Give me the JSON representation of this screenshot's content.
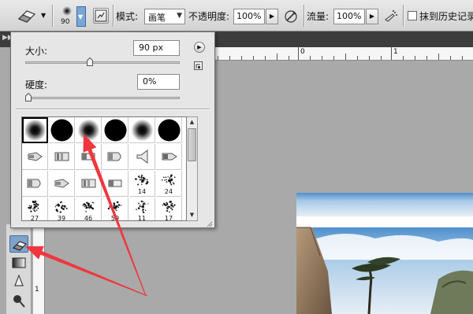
{
  "options_bar": {
    "brush_size_preview": "90",
    "mode_label": "模式:",
    "mode_value": "画笔",
    "opacity_label": "不透明度:",
    "opacity_value": "100%",
    "flow_label": "流量:",
    "flow_value": "100%",
    "erase_history_label": "抹到历史记录"
  },
  "brush_popup": {
    "size_label": "大小:",
    "size_value": "90 px",
    "size_slider_level": 0.42,
    "hardness_label": "硬度:",
    "hardness_value": "0%",
    "hardness_slider_level": 0.0,
    "presets": [
      {
        "kind": "soft",
        "label": ""
      },
      {
        "kind": "hard",
        "label": ""
      },
      {
        "kind": "soft",
        "label": ""
      },
      {
        "kind": "hard",
        "label": ""
      },
      {
        "kind": "soft",
        "label": ""
      },
      {
        "kind": "hard",
        "label": ""
      },
      {
        "kind": "marker",
        "label": ""
      },
      {
        "kind": "chalk",
        "label": ""
      },
      {
        "kind": "flat",
        "label": ""
      },
      {
        "kind": "wide",
        "label": ""
      },
      {
        "kind": "fan",
        "label": ""
      },
      {
        "kind": "pointed",
        "label": ""
      },
      {
        "kind": "wide",
        "label": ""
      },
      {
        "kind": "marker",
        "label": ""
      },
      {
        "kind": "chalk",
        "label": ""
      },
      {
        "kind": "flat",
        "label": ""
      },
      {
        "kind": "scatter",
        "label": "14"
      },
      {
        "kind": "scatter",
        "label": "24"
      },
      {
        "kind": "scatter",
        "label": "27"
      },
      {
        "kind": "scatter",
        "label": "39"
      },
      {
        "kind": "scatter",
        "label": "46"
      },
      {
        "kind": "scatter",
        "label": "59"
      },
      {
        "kind": "scatter",
        "label": "11"
      },
      {
        "kind": "scatter",
        "label": "17"
      }
    ]
  },
  "ruler": {
    "top_labels": [
      "0",
      "1"
    ],
    "left_labels": [
      "1"
    ]
  },
  "colors": {
    "annotation_arrow": "#f0363d",
    "tool_highlight": "#7fa3c8",
    "sky": "#7eb2de"
  }
}
